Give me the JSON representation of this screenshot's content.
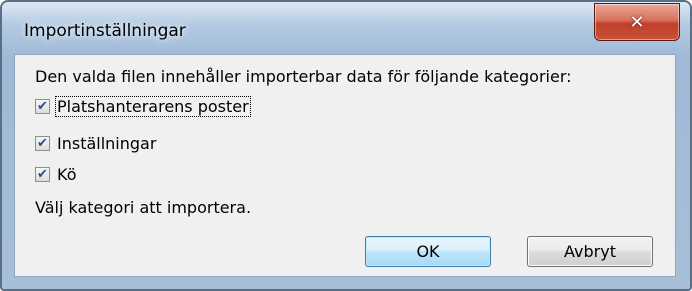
{
  "window": {
    "title": "Importinställningar",
    "close_icon": "✕"
  },
  "dialog": {
    "description": "Den valda filen innehåller importerbar data för följande kategorier:",
    "checkboxes": [
      {
        "label": "Platshanterarens poster",
        "checked": true
      },
      {
        "label": "Inställningar",
        "checked": true
      },
      {
        "label": "Kö",
        "checked": true
      }
    ],
    "instruction": "Välj kategori att importera.",
    "ok_label": "OK",
    "cancel_label": "Avbryt"
  },
  "colors": {
    "frame": "#a7bfd9",
    "close_button": "#c9513a",
    "client_background": "#f0f0f0",
    "check_mark": "#2b4f8a"
  }
}
